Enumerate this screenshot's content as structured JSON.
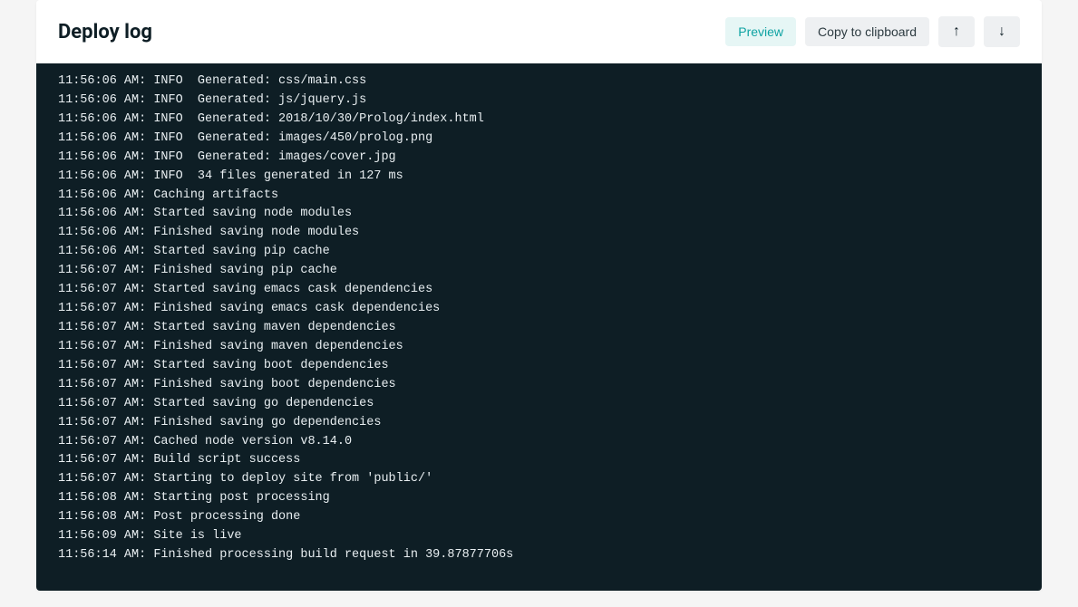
{
  "header": {
    "title": "Deploy log",
    "preview": "Preview",
    "copy": "Copy to clipboard",
    "scroll_up_icon": "↑",
    "scroll_down_icon": "↓"
  },
  "log_lines": [
    "11:56:06 AM: INFO  Generated: css/main.css",
    "11:56:06 AM: INFO  Generated: js/jquery.js",
    "11:56:06 AM: INFO  Generated: 2018/10/30/Prolog/index.html",
    "11:56:06 AM: INFO  Generated: images/450/prolog.png",
    "11:56:06 AM: INFO  Generated: images/cover.jpg",
    "11:56:06 AM: INFO  34 files generated in 127 ms",
    "11:56:06 AM: Caching artifacts",
    "11:56:06 AM: Started saving node modules",
    "11:56:06 AM: Finished saving node modules",
    "11:56:06 AM: Started saving pip cache",
    "11:56:07 AM: Finished saving pip cache",
    "11:56:07 AM: Started saving emacs cask dependencies",
    "11:56:07 AM: Finished saving emacs cask dependencies",
    "11:56:07 AM: Started saving maven dependencies",
    "11:56:07 AM: Finished saving maven dependencies",
    "11:56:07 AM: Started saving boot dependencies",
    "11:56:07 AM: Finished saving boot dependencies",
    "11:56:07 AM: Started saving go dependencies",
    "11:56:07 AM: Finished saving go dependencies",
    "11:56:07 AM: Cached node version v8.14.0",
    "11:56:07 AM: Build script success",
    "11:56:07 AM: Starting to deploy site from 'public/'",
    "11:56:08 AM: Starting post processing",
    "11:56:08 AM: Post processing done",
    "11:56:09 AM: Site is live",
    "11:56:14 AM: Finished processing build request in 39.87877706s"
  ]
}
